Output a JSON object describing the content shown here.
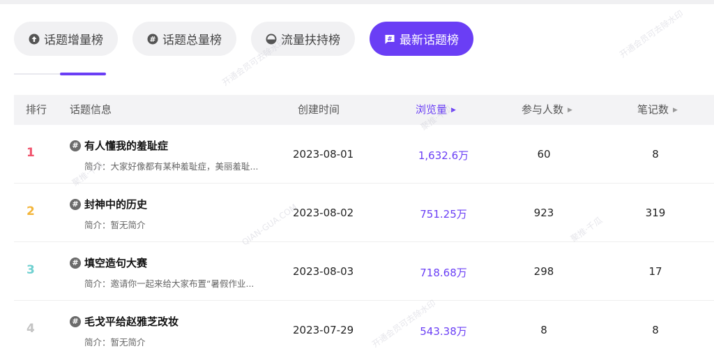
{
  "tabs": [
    {
      "label": "话题增量榜",
      "icon": "arrow-up-circle-icon",
      "active": false
    },
    {
      "label": "话题总量榜",
      "icon": "hash-circle-icon",
      "active": false
    },
    {
      "label": "流量扶持榜",
      "icon": "half-circle-icon",
      "active": false
    },
    {
      "label": "最新话题榜",
      "icon": "chat-hash-icon",
      "active": true
    }
  ],
  "table": {
    "headers": {
      "rank": "排行",
      "info": "话题信息",
      "created": "创建时间",
      "views": "浏览量",
      "participants": "参与人数",
      "notes": "笔记数"
    },
    "rows": [
      {
        "rank": "1",
        "title": "有人懂我的羞耻症",
        "desc": "简介：大家好像都有某种羞耻症，美丽羞耻...",
        "date": "2023-08-01",
        "views": "1,632.6万",
        "participants": "60",
        "notes": "8"
      },
      {
        "rank": "2",
        "title": "封神中的历史",
        "desc": "简介：暂无简介",
        "date": "2023-08-02",
        "views": "751.25万",
        "participants": "923",
        "notes": "319"
      },
      {
        "rank": "3",
        "title": "填空造句大赛",
        "desc": "简介：邀请你一起来给大家布置“暑假作业...",
        "date": "2023-08-03",
        "views": "718.68万",
        "participants": "298",
        "notes": "17"
      },
      {
        "rank": "4",
        "title": "毛戈平给赵雅芝改妆",
        "desc": "简介：暂无简介",
        "date": "2023-07-29",
        "views": "543.38万",
        "participants": "8",
        "notes": "8"
      }
    ]
  },
  "watermarks": {
    "vip": "开通会员可去除水印",
    "brand": "QIAN-GUA.COM",
    "logo": "聚推·千瓜"
  },
  "colors": {
    "accent": "#6a3ef5",
    "rank1": "#f0526b",
    "rank2": "#f3b53a",
    "rank3": "#6fd0d0",
    "rank4": "#c4c4c4"
  }
}
